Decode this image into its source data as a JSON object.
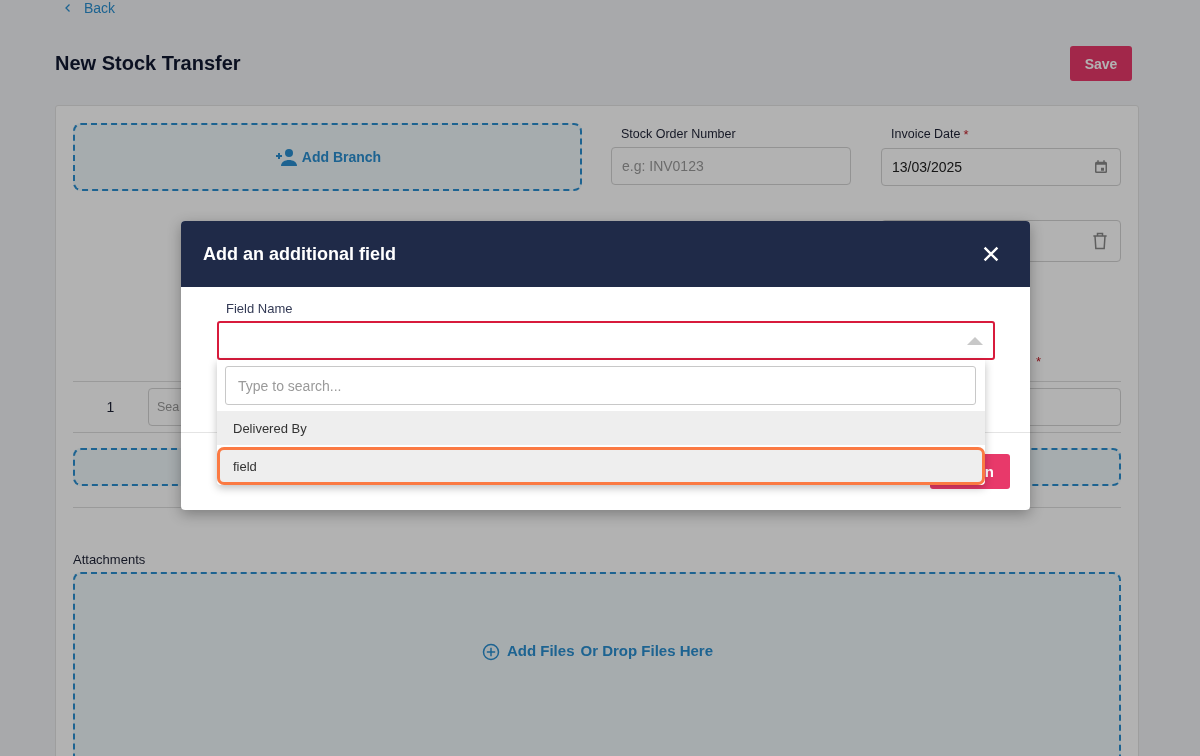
{
  "back_link": {
    "label": "Back"
  },
  "page_title": "New Stock Transfer",
  "save_button": {
    "label": "Save"
  },
  "form": {
    "add_branch": {
      "label": "Add Branch"
    },
    "fields": [
      {
        "label": "Stock Order Number",
        "required": false,
        "placeholder": "e.g: INV0123",
        "kind": "text"
      },
      {
        "label": "Invoice Date",
        "required": true,
        "value": "13/03/2025",
        "kind": "date"
      }
    ],
    "required_mark": "*",
    "removable_field": {
      "kind": "removable"
    },
    "stray_required_mark": "*"
  },
  "lines": [
    {
      "number": "1",
      "placeholder": "Sea"
    }
  ],
  "attachments": {
    "label": "Attachments",
    "add_files": "Add Files",
    "drop_hint": "Or Drop Files Here"
  },
  "modal": {
    "title": "Add an additional field",
    "field": {
      "label": "Field Name",
      "error": true,
      "expanded": true
    },
    "dropdown": {
      "placeholder": "Type to search...",
      "options": [
        {
          "label": "Delivered By",
          "selected": false
        },
        {
          "label": "field",
          "selected": true
        }
      ]
    },
    "confirm_button": {
      "label": "n"
    }
  }
}
